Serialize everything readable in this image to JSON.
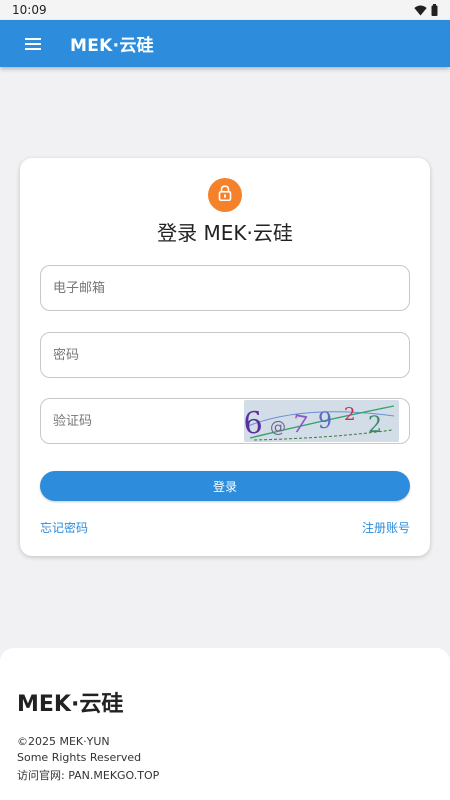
{
  "status_bar": {
    "time": "10:09"
  },
  "app_bar": {
    "title": "MEK·云硅"
  },
  "login": {
    "title": "登录 MEK·云硅",
    "email_placeholder": "电子邮箱",
    "password_placeholder": "密码",
    "captcha_placeholder": "验证码",
    "captcha_text": "6@792 2",
    "submit_label": "登录",
    "forgot_label": "忘记密码",
    "register_label": "注册账号"
  },
  "footer": {
    "brand": "MEK·云硅",
    "copyright": "©2025 MEK·YUN",
    "rights": "Some Rights Reserved",
    "site": "访问官网: PAN.MEKGO.TOP"
  },
  "colors": {
    "primary": "#2d8ddc",
    "accent": "#f5812a",
    "background": "#f1f1f3"
  },
  "icons": [
    "wifi-icon",
    "battery-icon",
    "menu-icon",
    "lock-icon",
    "captcha-image"
  ]
}
